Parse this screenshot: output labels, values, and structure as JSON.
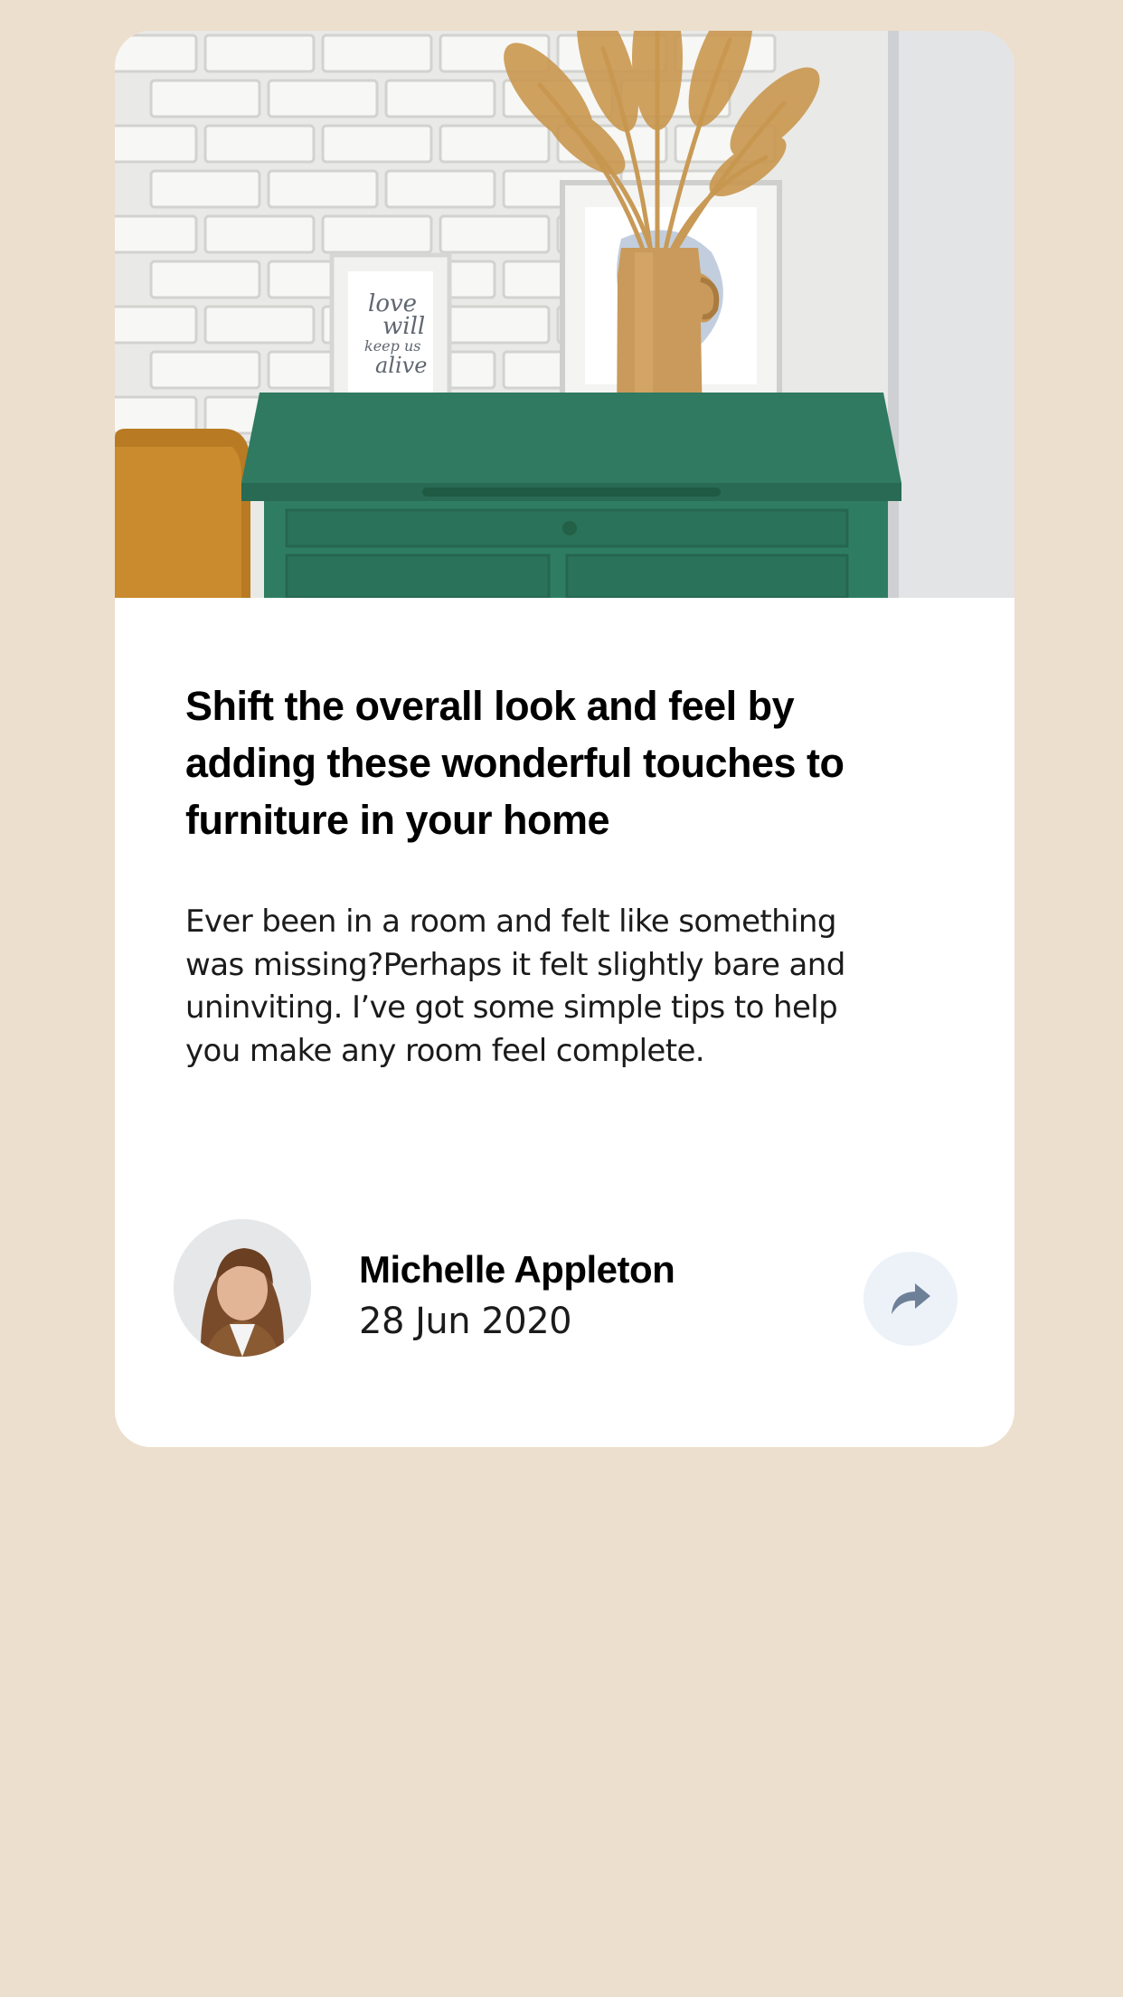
{
  "article": {
    "title": "Shift the overall look and feel by adding these wonderful touches to furniture in your home",
    "excerpt": "Ever been in a room and felt like something was missing?Perhaps it felt slightly bare and uninviting. I’ve got some simple tips to help you make any room feel complete.",
    "hero_frame_text": [
      "love",
      "will",
      "keep us",
      "alive"
    ]
  },
  "author": {
    "name": "Michelle Appleton",
    "date": "28 Jun 2020"
  },
  "share": {
    "icon": "share-icon"
  },
  "colors": {
    "page_background": "#ecdfcd",
    "card_background": "#ffffff",
    "dresser_green": "#2e7d62",
    "vase_tan": "#c99a5b",
    "share_bg": "#ecf2f8",
    "share_icon": "#6e8098"
  }
}
